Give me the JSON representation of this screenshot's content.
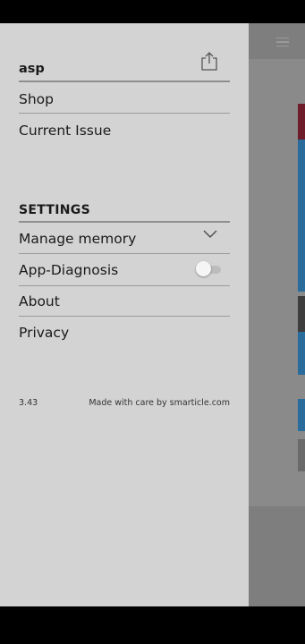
{
  "drawer": {
    "user_name": "asp",
    "menu_items": [
      {
        "label": "Shop"
      },
      {
        "label": "Current Issue"
      }
    ],
    "settings": {
      "title": "SETTINGS",
      "items": [
        {
          "label": "Manage memory"
        },
        {
          "label": "App-Diagnosis",
          "toggle_on": false
        },
        {
          "label": "About"
        },
        {
          "label": "Privacy"
        }
      ]
    },
    "footer": {
      "version": "3.43",
      "credit": "Made with care by smarticle.com"
    }
  },
  "icons": {
    "share": "share-icon",
    "chevron": "chevron-down-icon",
    "menu": "hamburger-menu-icon"
  },
  "colors": {
    "drawer_bg": "#d3d3d3",
    "overlay": "#7e7e7e",
    "accent_blue": "#2a6c9c"
  }
}
